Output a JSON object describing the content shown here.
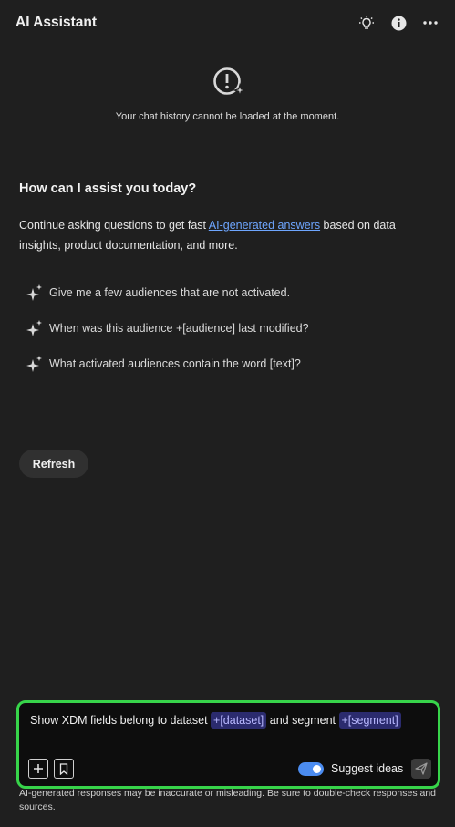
{
  "header": {
    "title": "AI Assistant",
    "icons": [
      "lightbulb-icon",
      "info-icon",
      "more-icon"
    ]
  },
  "error": {
    "icon": "error-sparkle-icon",
    "message": "Your chat history cannot be loaded at the moment."
  },
  "welcome": {
    "heading": "How can I assist you today?",
    "intro_before": "Continue asking questions to get fast ",
    "intro_link": "AI-generated answers",
    "intro_after": " based on data insights, product documentation, and more."
  },
  "suggestions": [
    {
      "icon": "sparkle-icon",
      "text": "Give me a few audiences that are not activated."
    },
    {
      "icon": "sparkle-icon",
      "text": "When was this audience +[audience] last modified?"
    },
    {
      "icon": "sparkle-icon",
      "text": "What activated audiences contain the word [text]?"
    }
  ],
  "refresh_label": "Refresh",
  "composer": {
    "text_1": "Show XDM fields belong to dataset ",
    "chip_1": "+[dataset]",
    "text_2": " and  segment ",
    "chip_2": "+[segment]",
    "suggest_label": "Suggest ideas",
    "suggest_on": true,
    "accent_color": "#37d44a",
    "toggle_color": "#4b8cf0"
  },
  "disclaimer": "AI-generated responses may be inaccurate or misleading. Be sure to double-check responses and sources."
}
